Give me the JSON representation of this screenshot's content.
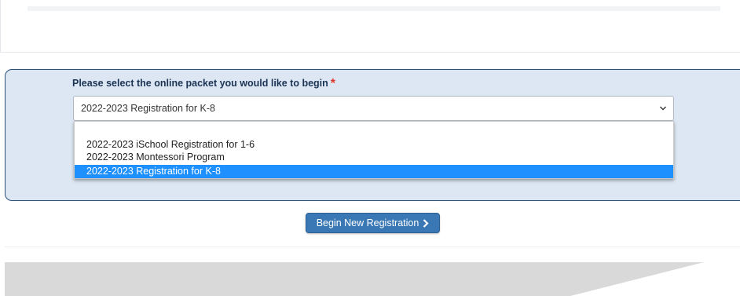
{
  "form": {
    "prompt": "Please select the online packet you would like to begin",
    "required_marker": "*",
    "selected_value": "2022-2023 Registration for K-8",
    "options": [
      {
        "label": "2022-2023 iSchool Registration for 1-6",
        "selected": false
      },
      {
        "label": "2022-2023 Montessori Program",
        "selected": false
      },
      {
        "label": "2022-2023 Registration for K-8",
        "selected": true
      }
    ],
    "submit_label": "Begin New Registration"
  },
  "colors": {
    "panel_bg": "#dde7f3",
    "panel_border": "#2d5079",
    "highlight": "#1e90ff",
    "button": "#3a78b5",
    "required": "#e0342a"
  },
  "icons": {
    "select_arrow": "chevron-down-icon",
    "button_arrow": "chevron-right-icon"
  }
}
